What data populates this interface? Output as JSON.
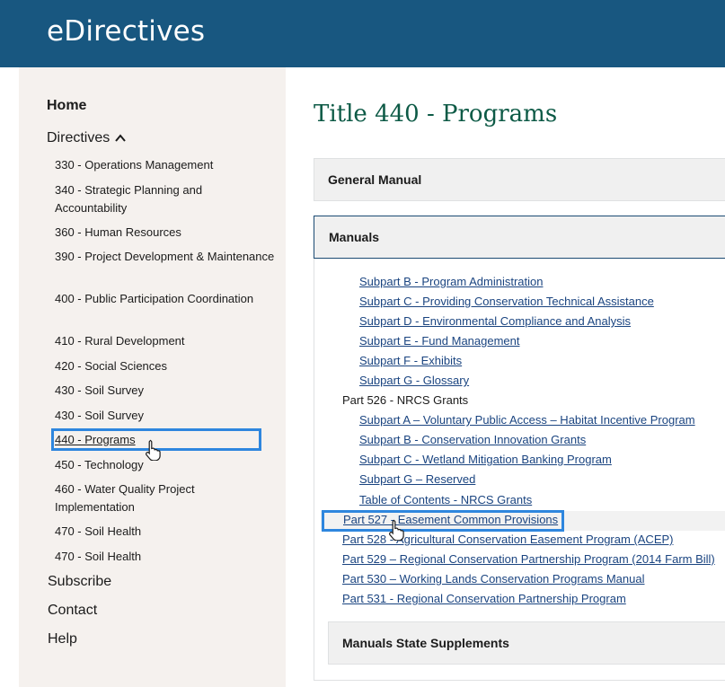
{
  "header": {
    "brand": "eDirectives"
  },
  "sidebar": {
    "home": "Home",
    "directives": "Directives",
    "items": [
      "330 - Operations Management",
      "340 - Strategic Planning and Accountability",
      "360 - Human Resources",
      "390 - Project Development & Maintenance",
      "400 - Public Participation Coordination",
      "410 - Rural Development",
      "420 - Social Sciences",
      "430 - Soil Survey",
      "430 - Soil Survey",
      "440 - Programs",
      "450 - Technology",
      "460 - Water Quality Project Implementation",
      "470 - Soil Health",
      "470 - Soil Health"
    ],
    "active_item": "440 - Programs",
    "bottom": [
      "Subscribe",
      "Contact",
      "Help"
    ]
  },
  "main": {
    "title": "Title 440 - Programs",
    "general_manual": "General Manual",
    "manuals": "Manuals",
    "manuals_state_supplements": "Manuals State Supplements",
    "entries": [
      {
        "text": "Subpart B - Program Administration",
        "link": true
      },
      {
        "text": "Subpart C - Providing Conservation Technical Assistance",
        "link": true
      },
      {
        "text": "Subpart D - Environmental Compliance and Analysis",
        "link": true
      },
      {
        "text": "Subpart E - Fund Management",
        "link": true
      },
      {
        "text": "Subpart F - Exhibits",
        "link": true
      },
      {
        "text": "Subpart G - Glossary",
        "link": true
      },
      {
        "text": "Part 526 - NRCS Grants",
        "link": false
      },
      {
        "text": "Subpart A – Voluntary Public Access – Habitat Incentive Program",
        "link": true
      },
      {
        "text": "Subpart B - Conservation Innovation Grants",
        "link": true
      },
      {
        "text": "Subpart C - Wetland Mitigation Banking Program",
        "link": true
      },
      {
        "text": "Subpart G – Reserved",
        "link": true
      },
      {
        "text": "Table of Contents - NRCS Grants",
        "link": true
      },
      {
        "text": "Part 527 - Easement Common Provisions",
        "link": true
      },
      {
        "text": "Part 528 - Agricultural Conservation Easement Program (ACEP)",
        "link": true
      },
      {
        "text": "Part 529 – Regional Conservation Partnership Program (2014 Farm Bill)",
        "link": true
      },
      {
        "text": "Part 530 – Working Lands Conservation Programs Manual",
        "link": true
      },
      {
        "text": "Part 531 - Regional Conservation Partnership Program",
        "link": true
      }
    ]
  },
  "colors": {
    "header_bg": "#185780",
    "sidebar_bg": "#f5f1ee",
    "title_green": "#0d5a46",
    "link_blue": "#1a4480",
    "highlight_blue": "#2e86de"
  },
  "icons": {
    "directives_toggle": "chevron-up-icon",
    "pointer": "hand-pointer-icon"
  }
}
